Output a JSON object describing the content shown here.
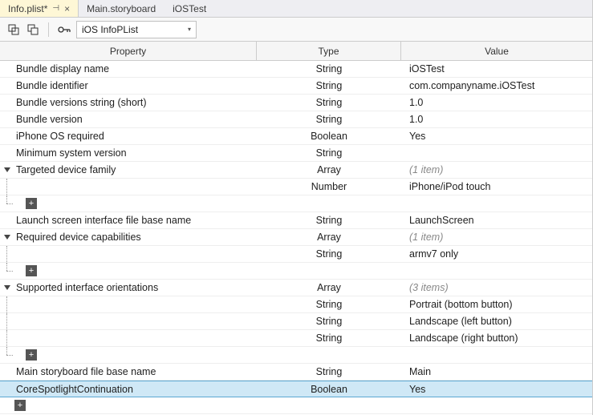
{
  "tabs": [
    {
      "label": "Info.plist*",
      "active": true,
      "pinned": true
    },
    {
      "label": "Main.storyboard",
      "active": false
    },
    {
      "label": "iOSTest",
      "active": false
    }
  ],
  "toolbar": {
    "dropdown_value": "iOS InfoPList"
  },
  "headers": {
    "property": "Property",
    "type": "Type",
    "value": "Value"
  },
  "rows": [
    {
      "kind": "leaf",
      "depth": 1,
      "toggle": "none",
      "prop": "Bundle display name",
      "type": "String",
      "value": "iOSTest"
    },
    {
      "kind": "leaf",
      "depth": 1,
      "toggle": "none",
      "prop": "Bundle identifier",
      "type": "String",
      "value": "com.companyname.iOSTest"
    },
    {
      "kind": "leaf",
      "depth": 1,
      "toggle": "none",
      "prop": "Bundle versions string (short)",
      "type": "String",
      "value": "1.0"
    },
    {
      "kind": "leaf",
      "depth": 1,
      "toggle": "none",
      "prop": "Bundle version",
      "type": "String",
      "value": "1.0"
    },
    {
      "kind": "leaf",
      "depth": 1,
      "toggle": "none",
      "prop": "iPhone OS required",
      "type": "Boolean",
      "value": "Yes"
    },
    {
      "kind": "leaf",
      "depth": 1,
      "toggle": "none",
      "prop": "Minimum system version",
      "type": "String",
      "value": ""
    },
    {
      "kind": "array",
      "depth": 0,
      "toggle": "open",
      "prop": "Targeted device family",
      "type": "Array",
      "value": "(1 item)",
      "italic": true
    },
    {
      "kind": "child",
      "depth": 1,
      "guide": "v",
      "prop": "",
      "type": "Number",
      "value": "iPhone/iPod touch"
    },
    {
      "kind": "add",
      "depth": 1,
      "guide": "l"
    },
    {
      "kind": "leaf",
      "depth": 1,
      "toggle": "none",
      "prop": "Launch screen interface file base name",
      "type": "String",
      "value": "LaunchScreen"
    },
    {
      "kind": "array",
      "depth": 0,
      "toggle": "open",
      "prop": "Required device capabilities",
      "type": "Array",
      "value": "(1 item)",
      "italic": true
    },
    {
      "kind": "child",
      "depth": 1,
      "guide": "v",
      "prop": "",
      "type": "String",
      "value": "armv7 only"
    },
    {
      "kind": "add",
      "depth": 1,
      "guide": "l"
    },
    {
      "kind": "array",
      "depth": 0,
      "toggle": "open",
      "prop": "Supported interface orientations",
      "type": "Array",
      "value": "(3 items)",
      "italic": true
    },
    {
      "kind": "child",
      "depth": 1,
      "guide": "v",
      "prop": "",
      "type": "String",
      "value": "Portrait (bottom button)"
    },
    {
      "kind": "child",
      "depth": 1,
      "guide": "v",
      "prop": "",
      "type": "String",
      "value": "Landscape (left button)"
    },
    {
      "kind": "child",
      "depth": 1,
      "guide": "v",
      "prop": "",
      "type": "String",
      "value": "Landscape (right button)"
    },
    {
      "kind": "add",
      "depth": 1,
      "guide": "l"
    },
    {
      "kind": "leaf",
      "depth": 1,
      "toggle": "none",
      "prop": "Main storyboard file base name",
      "type": "String",
      "value": "Main"
    },
    {
      "kind": "leaf",
      "depth": 1,
      "toggle": "none",
      "prop": "CoreSpotlightContinuation",
      "type": "Boolean",
      "value": "Yes",
      "selected": true
    },
    {
      "kind": "addroot"
    }
  ]
}
